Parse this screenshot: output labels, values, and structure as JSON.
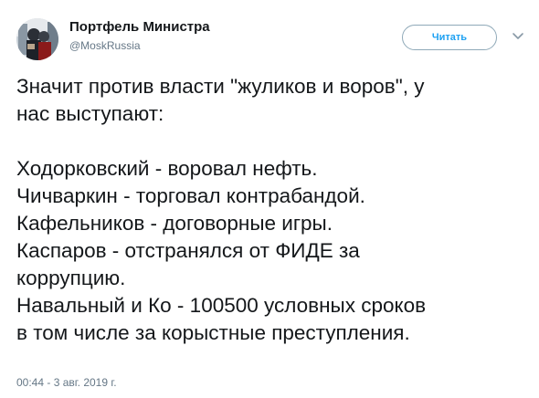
{
  "tweet": {
    "author": {
      "name": "Портфель Министра",
      "handle": "@MoskRussia"
    },
    "follow_label": "Читать",
    "text_lines": [
      "Значит против власти \"жуликов и воров\", у",
      "нас выступают:",
      "",
      "Ходорковский - воровал нефть.",
      "Чичваркин - торговал контрабандой.",
      "Кафельников - договорные игры.",
      "Каспаров - отстранялся от ФИДЕ за",
      "коррупцию.",
      "Навальный и Ко - 100500 условных сроков",
      "в том числе за корыстные преступления."
    ],
    "timestamp": "00:44 - 3 авг. 2019 г."
  },
  "icons": {
    "avatar": "avatar-photo",
    "menu": "chevron-down-icon"
  },
  "colors": {
    "text": "#14171a",
    "secondary": "#657786",
    "accent": "#1da1f2",
    "follow_border": "#8fa9b8"
  }
}
